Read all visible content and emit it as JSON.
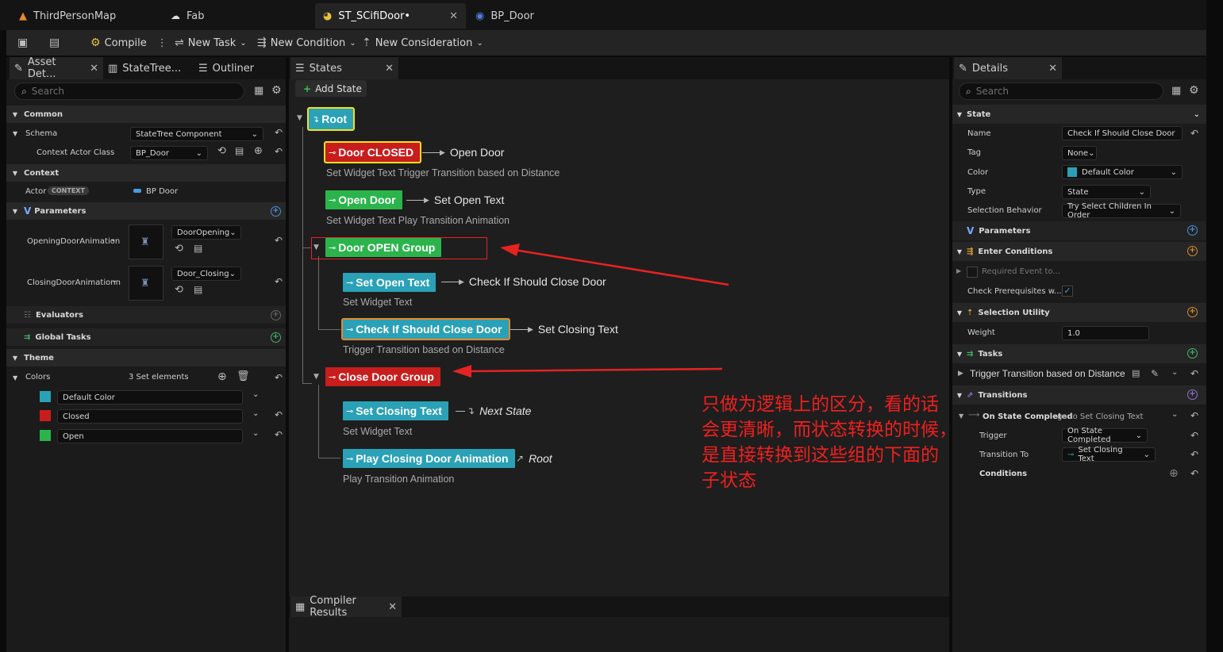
{
  "tabs": [
    {
      "label": "ThirdPersonMap",
      "icon": "map-icon"
    },
    {
      "label": "Fab",
      "icon": "fab-icon"
    },
    {
      "label": "ST_SCifiDoor•",
      "icon": "statetree-icon"
    },
    {
      "label": "BP_Door",
      "icon": "blueprint-icon"
    }
  ],
  "toolbar": {
    "compile": "Compile",
    "new_task": "New Task",
    "new_condition": "New Condition",
    "new_consideration": "New Consideration"
  },
  "left_panel": {
    "tabs": [
      "Asset Det...",
      "StateTree...",
      "Outliner"
    ],
    "search_placeholder": "Search",
    "common": "Common",
    "schema_label": "Schema",
    "schema_value": "StateTree Component",
    "context_actor_class_label": "Context Actor Class",
    "context_actor_class_value": "BP_Door",
    "context": "Context",
    "actor_label": "Actor",
    "actor_badge": "CONTEXT",
    "actor_value": "BP Door",
    "parameters": "Parameters",
    "param1_label": "OpeningDoorAnimation",
    "param1_value": "DoorOpening",
    "param2_label": "ClosingDoorAnimationn",
    "param2_value": "Door_Closing",
    "evaluators": "Evaluators",
    "global_tasks": "Global Tasks",
    "theme": "Theme",
    "colors_label": "Colors",
    "colors_value": "3 Set elements",
    "color_items": [
      {
        "name": "Default Color",
        "color": "#2aa1b6"
      },
      {
        "name": "Closed",
        "color": "#c81d1d"
      },
      {
        "name": "Open",
        "color": "#2bb44b"
      }
    ]
  },
  "states_panel": {
    "tab": "States",
    "add_state": "Add State",
    "root": "Root",
    "door_closed": "Door CLOSED",
    "door_closed_to": "Open Door",
    "door_closed_sub": "Set Widget Text   Trigger Transition based on Distance",
    "open_door": "Open Door",
    "open_door_to": "Set Open Text",
    "open_door_sub": "Set Widget Text   Play Transition Animation",
    "door_open_group": "Door OPEN Group",
    "set_open_text": "Set Open Text",
    "set_open_text_to": "Check If Should Close Door",
    "set_open_text_sub": "Set Widget Text",
    "check_close": "Check If Should Close Door",
    "check_close_to": "Set Closing Text",
    "check_close_sub": "Trigger Transition based on Distance",
    "close_door_group": "Close Door Group",
    "set_closing_text": "Set Closing Text",
    "set_closing_text_to": "Next State",
    "set_closing_text_sub": "Set Widget Text",
    "play_closing": "Play Closing Door Animation",
    "play_closing_to": "Root",
    "play_closing_sub": "Play Transition Animation",
    "compiler_results": "Compiler Results"
  },
  "annotation": {
    "line1": "只做为逻辑上的区分，看的话",
    "line2": "会更清晰，而状态转换的时候，",
    "line3": "是直接转换到这些组的下面的",
    "line4": "子状态"
  },
  "details": {
    "tab": "Details",
    "search_placeholder": "Search",
    "state": "State",
    "name_label": "Name",
    "name_value": "Check If Should Close Door",
    "tag_label": "Tag",
    "tag_value": "None",
    "color_label": "Color",
    "color_value": "Default Color",
    "type_label": "Type",
    "type_value": "State",
    "selection_behavior_label": "Selection Behavior",
    "selection_behavior_value": "Try Select Children In Order",
    "parameters": "Parameters",
    "enter_conditions": "Enter Conditions",
    "required_event": "Required Event to...",
    "check_prereq": "Check Prerequisites w...",
    "selection_utility": "Selection Utility",
    "weight_label": "Weight",
    "weight_value": "1.0",
    "tasks": "Tasks",
    "task1": "Trigger Transition based on Distance",
    "transitions": "Transitions",
    "on_state_completed": "On State Completed",
    "go_to": "go to Set Closing Text",
    "trigger_label": "Trigger",
    "trigger_value": "On State Completed",
    "transition_to_label": "Transition To",
    "transition_to_value": "Set Closing Text",
    "conditions": "Conditions"
  }
}
